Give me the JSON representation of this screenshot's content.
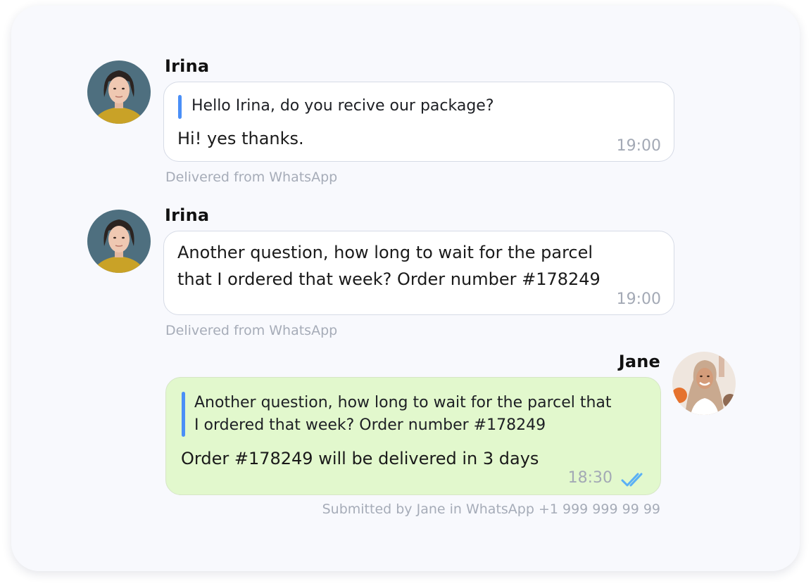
{
  "messages": [
    {
      "sender": "Irina",
      "quote": "Hello Irina, do you recive our package?",
      "text": "Hi! yes thanks.",
      "time": "19:00",
      "footnote": "Delivered from WhatsApp"
    },
    {
      "sender": "Irina",
      "text": "Another question, how long to wait for the parcel\nthat I ordered that week? Order number #178249",
      "time": "19:00",
      "footnote": "Delivered from WhatsApp"
    },
    {
      "sender": "Jane",
      "quote": "Another question, how long to wait for the parcel that\nI ordered that week? Order number #178249",
      "text": "Order #178249 will be delivered in 3 days",
      "time": "18:30",
      "status_icon": "double-check-icon",
      "footnote": "Submitted by Jane in WhatsApp +1 999 999 99 99"
    }
  ],
  "colors": {
    "card_bg": "#f8f9fd",
    "incoming_bubble": "#ffffff",
    "outgoing_bubble": "#e2f8cd",
    "quote_bar": "#4a8ff7",
    "read_ticks": "#5ab0f5",
    "muted_text": "#a6acb8"
  }
}
